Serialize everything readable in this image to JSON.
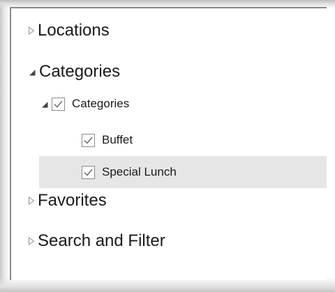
{
  "tree": {
    "locations": {
      "label": "Locations",
      "icon": "triangle-right-icon"
    },
    "categories": {
      "label": "Categories",
      "icon": "triangle-down-icon",
      "group": {
        "label": "Categories",
        "checked": true,
        "items": [
          {
            "label": "Buffet",
            "checked": true,
            "selected": false
          },
          {
            "label": "Special Lunch",
            "checked": true,
            "selected": true
          }
        ]
      }
    },
    "favorites": {
      "label": "Favorites",
      "icon": "triangle-right-icon"
    },
    "search_filter": {
      "label": "Search and Filter",
      "icon": "triangle-right-icon"
    }
  },
  "colors": {
    "selection": "#e6e6e6",
    "text": "#1a1a1a",
    "glyph": "#8f8f8f"
  }
}
